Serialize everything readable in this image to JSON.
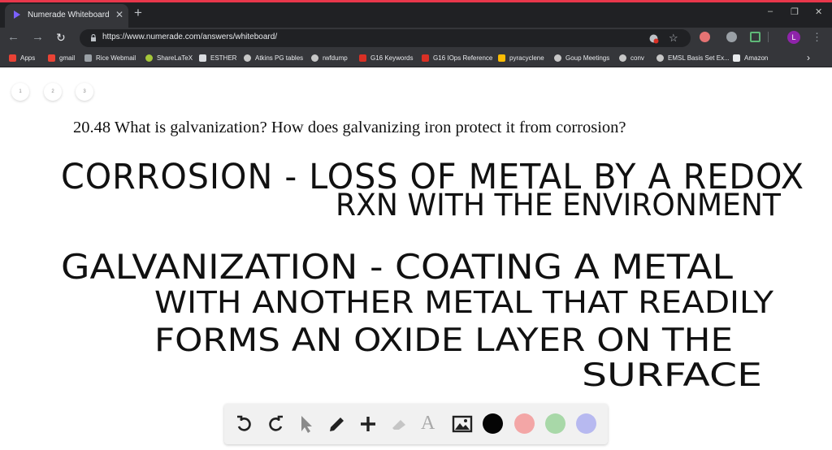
{
  "browser": {
    "tab_title": "Numerade Whiteboard",
    "tab_close": "✕",
    "new_tab": "+",
    "url": "https://www.numerade.com/answers/whiteboard/",
    "window_controls": [
      "–",
      "❐",
      "✕"
    ],
    "avatar_letter": "L",
    "accent_color": "#e8374b",
    "bookmarks": [
      {
        "label": "Apps",
        "icon": "apps-grid-icon",
        "color": "#e94235"
      },
      {
        "label": "gmail",
        "icon": "gmail-icon",
        "color": "#ea4335"
      },
      {
        "label": "Rice Webmail",
        "icon": "rice-icon",
        "color": "#9aa0a6"
      },
      {
        "label": "ShareLaTeX",
        "icon": "sharelatex-icon",
        "color": "#a5c73a"
      },
      {
        "label": "ESTHER",
        "icon": "page-icon",
        "color": "#dadce0"
      },
      {
        "label": "Atkins PG tables",
        "icon": "globe-icon",
        "color": "#c7c7c7"
      },
      {
        "label": "rwfdump",
        "icon": "globe-icon",
        "color": "#c7c7c7"
      },
      {
        "label": "G16 Keywords",
        "icon": "gaussian-icon",
        "color": "#d93025"
      },
      {
        "label": "G16 IOps Reference",
        "icon": "gaussian-icon",
        "color": "#d93025"
      },
      {
        "label": "pyracyclene",
        "icon": "folder-icon",
        "color": "#fbbc04"
      },
      {
        "label": "Goup Meetings",
        "icon": "globe-icon",
        "color": "#c7c7c7"
      },
      {
        "label": "conv",
        "icon": "globe-icon",
        "color": "#c7c7c7"
      },
      {
        "label": "EMSL Basis Set Ex...",
        "icon": "globe-icon",
        "color": "#c7c7c7"
      },
      {
        "label": "Amazon",
        "icon": "amazon-icon",
        "color": "#e8eaed"
      }
    ],
    "bookmarks_more": "›"
  },
  "whiteboard": {
    "pages": [
      "1",
      "2",
      "3"
    ],
    "question": "20.48 What is galvanization? How does galvanizing iron protect it from corrosion?",
    "handwriting": [
      "CORROSION - LOSS OF METAL BY A REDOX",
      "RXN WITH THE ENVIRONMENT",
      "GALVANIZATION - COATING A METAL",
      "WITH ANOTHER METAL THAT READILY",
      "FORMS AN OXIDE LAYER ON THE",
      "SURFACE"
    ],
    "ink_color": "#111111",
    "text_tool_label": "A"
  },
  "drawbar": {
    "tools": [
      "undo-icon",
      "redo-icon",
      "pointer-icon",
      "pen-icon",
      "plus-icon",
      "eraser-icon",
      "text-icon",
      "image-icon"
    ],
    "colors": [
      "#050505",
      "#f3a6a6",
      "#a8d8a8",
      "#b7b9f0"
    ]
  }
}
